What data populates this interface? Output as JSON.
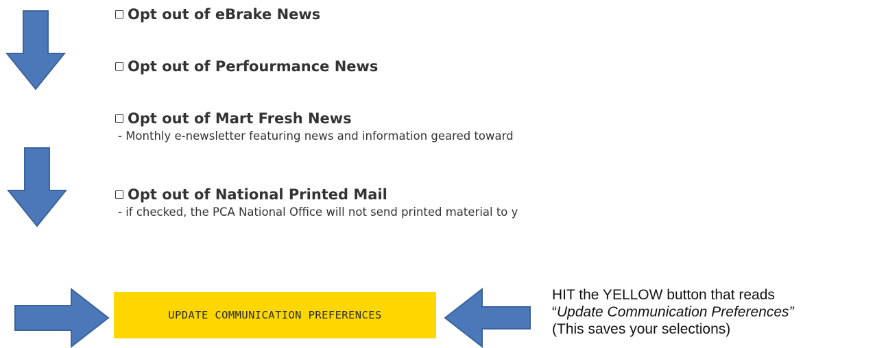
{
  "options": [
    {
      "label": "Opt out of eBrake News",
      "description": ""
    },
    {
      "label": "Opt out of Perfourmance News",
      "description": ""
    },
    {
      "label": "Opt out of Mart Fresh News",
      "description": "- Monthly e-newsletter featuring news and information geared toward"
    },
    {
      "label": "Opt out of National Printed Mail",
      "description": "- if checked, the PCA National Office will not send printed material to y"
    }
  ],
  "update_button": {
    "label": "UPDATE COMMUNICATION PREFERENCES",
    "color": "#fed701"
  },
  "instruction": {
    "line1": "HIT the YELLOW button that reads",
    "line2_open_quote": "“",
    "line2_italic": "Update Communication Preferences”",
    "line3": "(This saves your selections)"
  },
  "arrow_color": "#4a78b8",
  "arrow_outline": "#3b639c"
}
